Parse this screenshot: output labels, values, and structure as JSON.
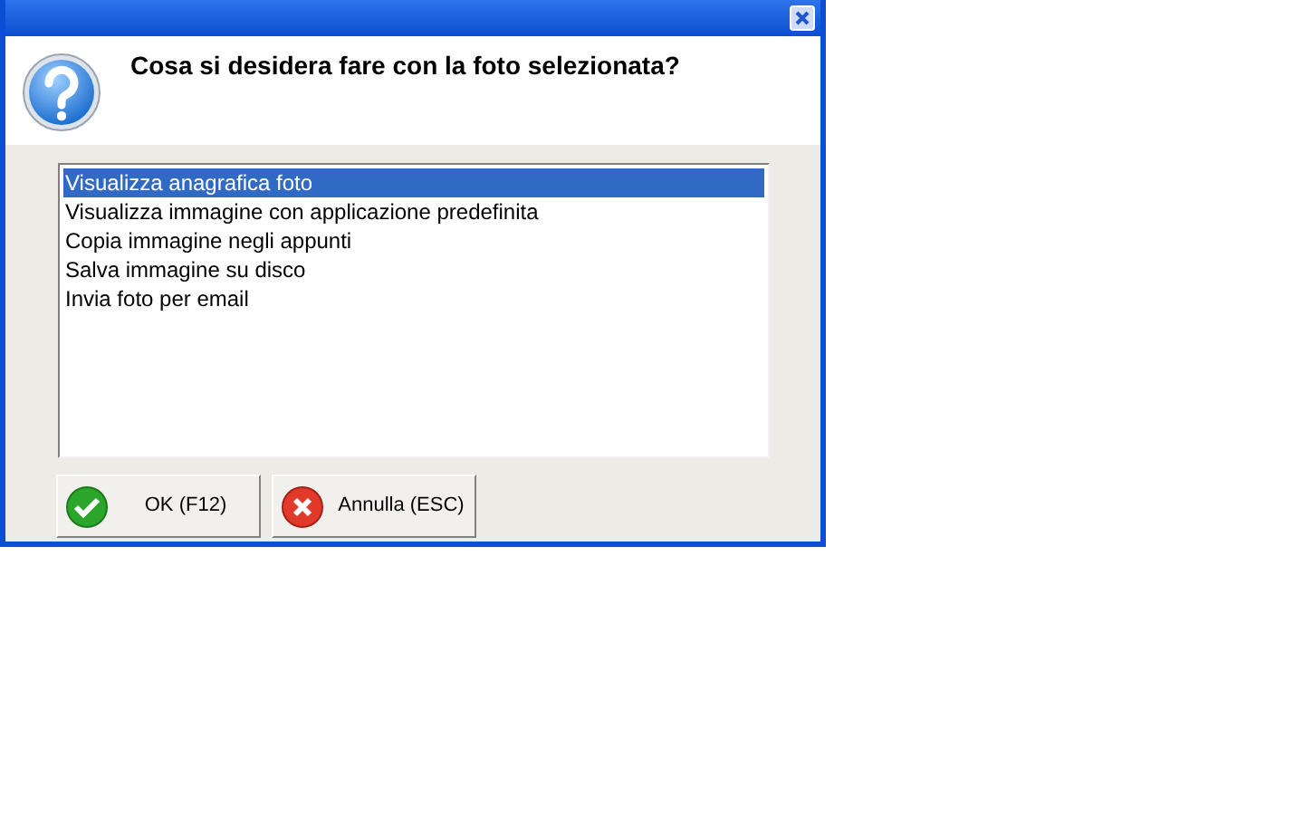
{
  "dialog": {
    "message": "Cosa si desidera fare con la foto selezionata?"
  },
  "options": [
    {
      "label": "Visualizza anagrafica foto",
      "selected": true
    },
    {
      "label": "Visualizza immagine con applicazione predefinita",
      "selected": false
    },
    {
      "label": "Copia immagine negli appunti",
      "selected": false
    },
    {
      "label": "Salva immagine su disco",
      "selected": false
    },
    {
      "label": "Invia foto per email",
      "selected": false
    }
  ],
  "buttons": [
    {
      "kind": "ok",
      "label": "OK (F12)"
    },
    {
      "kind": "cancel",
      "label": "Annulla (ESC)"
    }
  ]
}
